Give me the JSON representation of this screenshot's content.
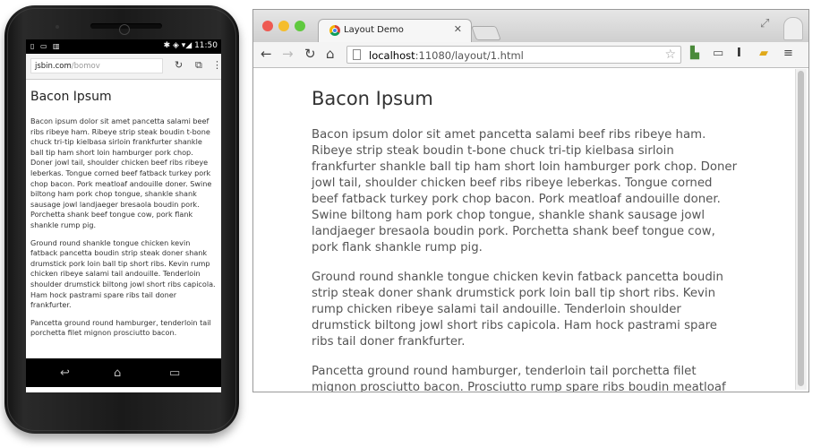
{
  "phone": {
    "status": {
      "left_icons": "▯ ▭ ▥",
      "right_icons": "✱ ◈ ▾◢",
      "time": "11:50"
    },
    "url": {
      "host": "jsbin.com",
      "path": "/bomov"
    },
    "title": "Bacon Ipsum",
    "paragraphs": [
      "Bacon ipsum dolor sit amet pancetta salami beef ribs ribeye ham. Ribeye strip steak boudin t-bone chuck tri-tip kielbasa sirloin frankfurter shankle ball tip ham short loin hamburger pork chop. Doner jowl tail, shoulder chicken beef ribs ribeye leberkas. Tongue corned beef fatback turkey pork chop bacon. Pork meatloaf andouille doner. Swine biltong ham pork chop tongue, shankle shank sausage jowl landjaeger bresaola boudin pork. Porchetta shank beef tongue cow, pork flank shankle rump pig.",
      "Ground round shankle tongue chicken kevin fatback pancetta boudin strip steak doner shank drumstick pork loin ball tip short ribs. Kevin rump chicken ribeye salami tail andouille. Tenderloin shoulder drumstick biltong jowl short ribs capicola. Ham hock pastrami spare ribs tail doner frankfurter.",
      "Pancetta ground round hamburger, tenderloin tail porchetta filet mignon prosciutto bacon."
    ]
  },
  "browser": {
    "tab_label": "Layout Demo",
    "url_host": "localhost",
    "url_rest": ":11080/layout/1.html",
    "title": "Bacon Ipsum",
    "paragraphs": [
      "Bacon ipsum dolor sit amet pancetta salami beef ribs ribeye ham. Ribeye strip steak boudin t-bone chuck tri-tip kielbasa sirloin frankfurter shankle ball tip ham short loin hamburger pork chop. Doner jowl tail, shoulder chicken beef ribs ribeye leberkas. Tongue corned beef fatback turkey pork chop bacon. Pork meatloaf andouille doner. Swine biltong ham pork chop tongue, shankle shank sausage jowl landjaeger bresaola boudin pork. Porchetta shank beef tongue cow, pork flank shankle rump pig.",
      "Ground round shankle tongue chicken kevin fatback pancetta boudin strip steak doner shank drumstick pork loin ball tip short ribs. Kevin rump chicken ribeye salami tail andouille. Tenderloin shoulder drumstick biltong jowl short ribs capicola. Ham hock pastrami spare ribs tail doner frankfurter.",
      "Pancetta ground round hamburger, tenderloin tail porchetta filet mignon prosciutto bacon. Prosciutto rump spare ribs boudin meatloaf doner flank chuck. Prosciutto leberkas ground round, sirloin tail flank filet mignon spare ribs ham turducken jowl swine pork loin shankle. Tri-tip rump doner andouille"
    ]
  },
  "colors": {
    "close": "#ee5a52",
    "minimize": "#f5bd2c",
    "zoom": "#5fc93e"
  }
}
